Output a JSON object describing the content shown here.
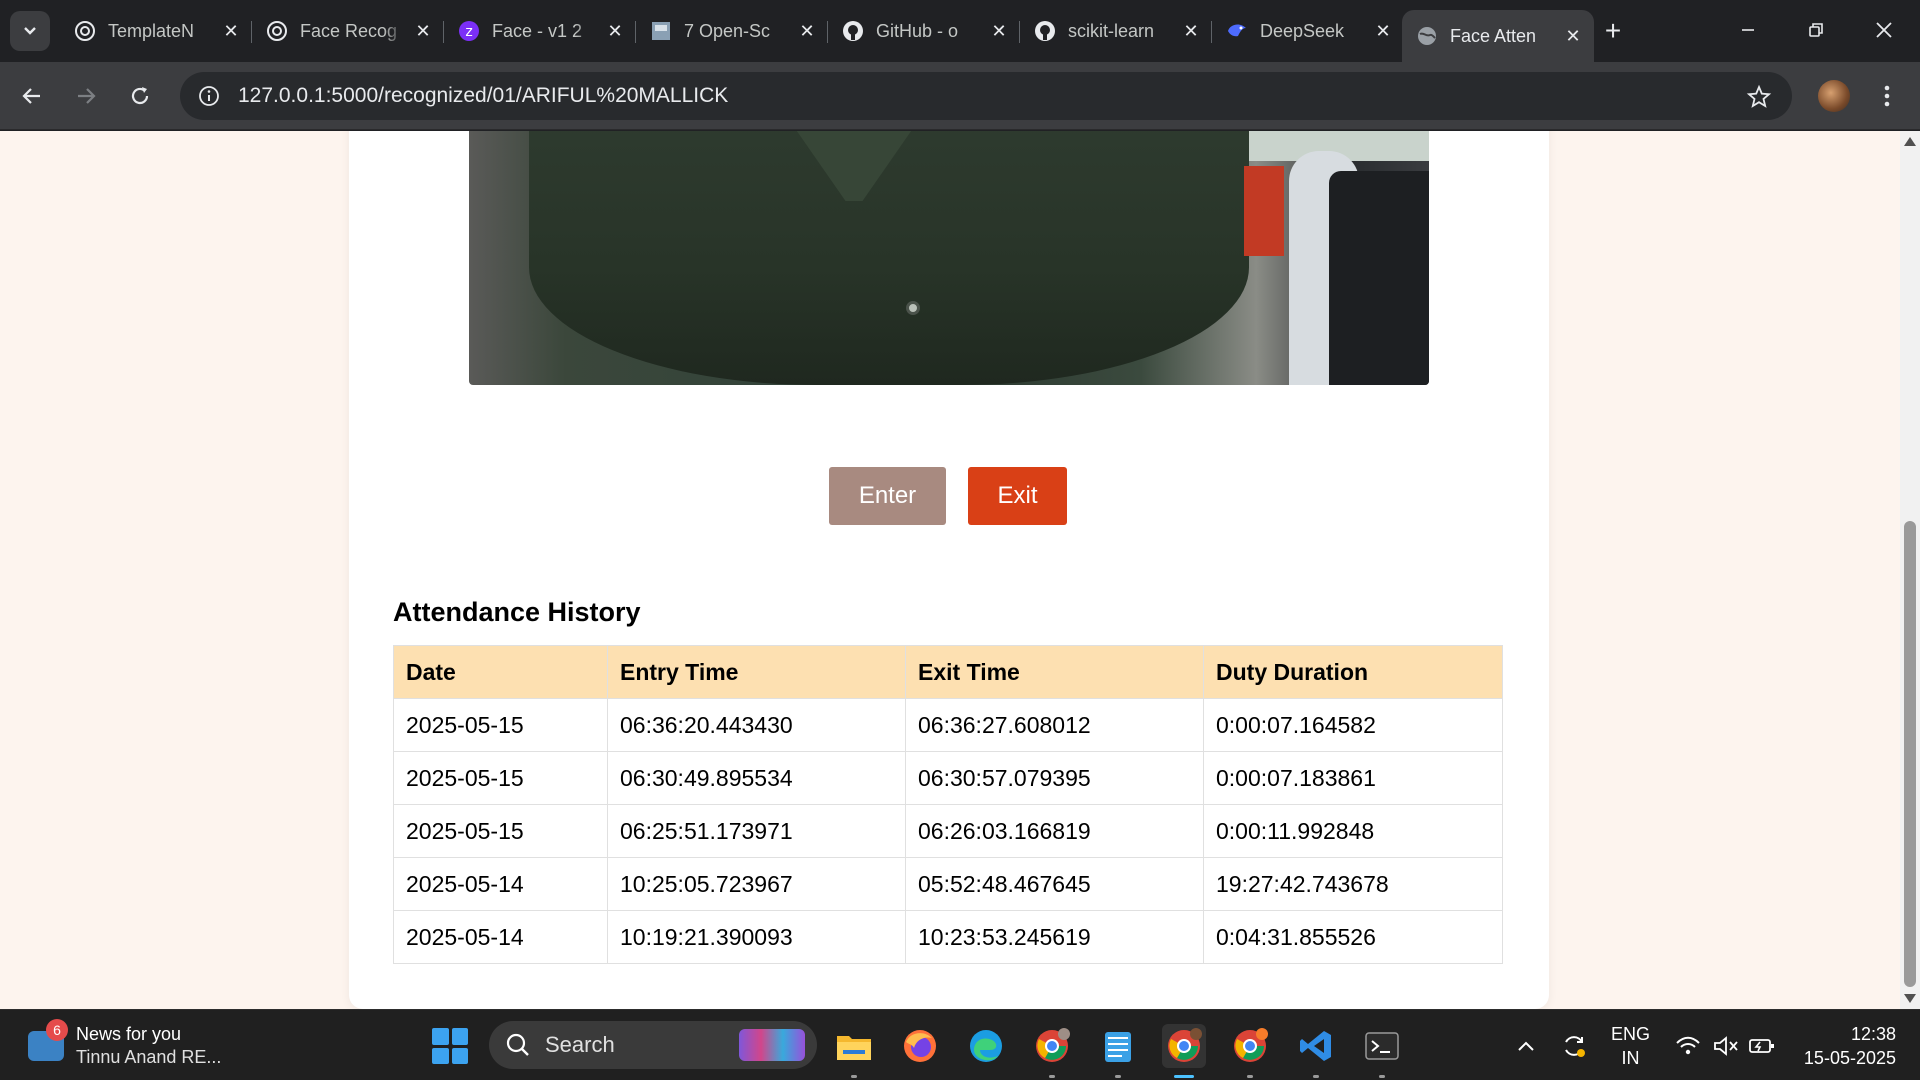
{
  "browser": {
    "tabs": [
      {
        "title": "TemplateN",
        "icon": "openai-icon"
      },
      {
        "title": "Face Recog",
        "icon": "openai-icon"
      },
      {
        "title": "Face - v1 2",
        "icon": "roboflow-icon"
      },
      {
        "title": "7 Open-Sc",
        "icon": "page-thumbnail-icon"
      },
      {
        "title": "GitHub - o",
        "icon": "github-icon"
      },
      {
        "title": "scikit-learn",
        "icon": "github-icon"
      },
      {
        "title": "DeepSeek",
        "icon": "deepseek-icon"
      },
      {
        "title": "Face Atten",
        "icon": "globe-icon",
        "active": true
      }
    ],
    "url": "127.0.0.1:5000/recognized/01/ARIFUL%20MALLICK"
  },
  "page": {
    "buttons": {
      "enter": "Enter",
      "exit": "Exit"
    },
    "history_title": "Attendance History",
    "table": {
      "headers": [
        "Date",
        "Entry Time",
        "Exit Time",
        "Duty Duration"
      ],
      "rows": [
        [
          "2025-05-15",
          "06:36:20.443430",
          "06:36:27.608012",
          "0:00:07.164582"
        ],
        [
          "2025-05-15",
          "06:30:49.895534",
          "06:30:57.079395",
          "0:00:07.183861"
        ],
        [
          "2025-05-15",
          "06:25:51.173971",
          "06:26:03.166819",
          "0:00:11.992848"
        ],
        [
          "2025-05-14",
          "10:25:05.723967",
          "05:52:48.467645",
          "19:27:42.743678"
        ],
        [
          "2025-05-14",
          "10:19:21.390093",
          "10:23:53.245619",
          "0:04:31.855526"
        ]
      ]
    },
    "colors": {
      "enter": "#a88a80",
      "exit": "#d94016",
      "table_header": "#fde0b1",
      "page_bg": "#fdf4ee"
    }
  },
  "taskbar": {
    "news": {
      "badge": "6",
      "title": "News for you",
      "subtitle": "Tinnu Anand RE..."
    },
    "search_label": "Search",
    "apps": [
      "file-explorer-icon",
      "firefox-icon",
      "edge-icon",
      "chrome-profile-d-icon",
      "notepad-icon",
      "chrome-icon",
      "chrome-profile-a-icon",
      "vscode-icon",
      "terminal-icon"
    ],
    "lang": {
      "line1": "ENG",
      "line2": "IN"
    },
    "clock": {
      "time": "12:38",
      "date": "15-05-2025"
    }
  }
}
